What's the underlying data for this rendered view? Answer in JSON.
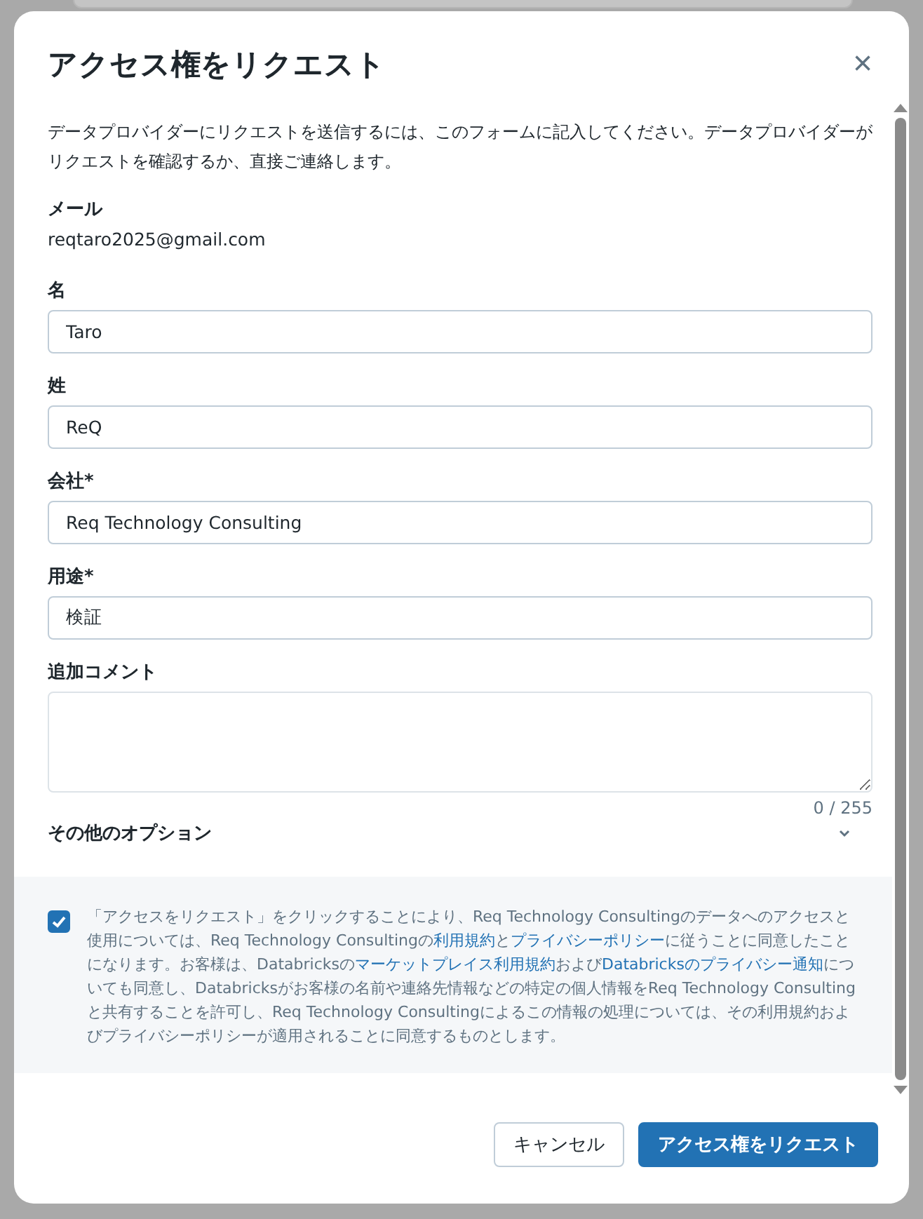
{
  "dialog": {
    "title": "アクセス権をリクエスト",
    "close": "×"
  },
  "intro": "データプロバイダーにリクエストを送信するには、このフォームに記入してください。データプロバイダーがリクエストを確認するか、直接ご連絡します。",
  "email": {
    "label": "メール",
    "value": "reqtaro2025@gmail.com"
  },
  "fields": [
    {
      "label": "名",
      "value": "Taro"
    },
    {
      "label": "姓",
      "value": "ReQ"
    },
    {
      "label": "会社*",
      "value": "Req Technology Consulting"
    },
    {
      "label": "用途*",
      "value": "検証"
    }
  ],
  "comment": {
    "label": "追加コメント",
    "counter": "0 / 255"
  },
  "more_options": {
    "label": "その他のオプション",
    "expanded": false
  },
  "consent": {
    "checked": true,
    "segments": [
      {
        "text": "「アクセスをリクエスト」をクリックすることにより、Req Technology Consultingのデータへのアクセスと使用については、Req Technology Consultingの",
        "link": false
      },
      {
        "text": "利用規約",
        "link": true
      },
      {
        "text": "と",
        "link": false
      },
      {
        "text": "プライバシーポリシー",
        "link": true
      },
      {
        "text": "に従うことに同意したことになります。お客様は、Databricksの",
        "link": false
      },
      {
        "text": "マーケットプレイス利用規約",
        "link": true
      },
      {
        "text": "および",
        "link": false
      },
      {
        "text": "Databricksのプライバシー通知",
        "link": true
      },
      {
        "text": "についても同意し、Databricksがお客様の名前や連絡先情報などの特定の個人情報をReq Technology Consultingと共有することを許可し、Req Technology Consultingによるこの情報の処理については、その利用規約およびプライバシーポリシーが適用されることに同意するものとします。",
        "link": false
      }
    ]
  },
  "buttons": [
    {
      "label": "キャンセル",
      "kind": "secondary"
    },
    {
      "label": "アクセス権をリクエスト",
      "kind": "primary"
    }
  ]
}
